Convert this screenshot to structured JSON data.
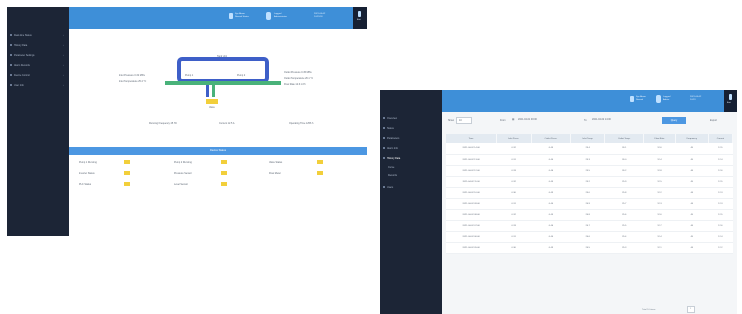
{
  "left_screen": {
    "topbar": {
      "items": [
        {
          "icon": "monitor-icon",
          "line1": "Sys Alarm",
          "line2": "Normal Status"
        },
        {
          "icon": "user-icon",
          "line1": "Logged",
          "line2": "Administrator"
        },
        {
          "icon": "clock-icon",
          "line1": "2021-04-02",
          "line2": "14:23:18"
        }
      ],
      "power_label": "Exit"
    },
    "sidebar": {
      "items": [
        {
          "label": "Real-time Status",
          "active": true
        },
        {
          "label": "History Data",
          "active": false
        },
        {
          "label": "Parameter Settings",
          "active": false
        },
        {
          "label": "Alarm Records",
          "active": false
        },
        {
          "label": "Device Control",
          "active": false
        },
        {
          "label": "User Info",
          "active": false
        }
      ]
    },
    "diagram": {
      "top_label": "Tank Unit",
      "left_box": "Pump 1",
      "right_box": "Pump 2",
      "left_notes": [
        "Inlet Pressure 0.32 MPa",
        "Inlet Temperature 25.4 °C"
      ],
      "right_notes": [
        "Outlet Pressure 0.45 MPa",
        "Outlet Temperature 26.1 °C",
        "Flow Rate 12.6 m³/h"
      ],
      "valve_label": "Valve",
      "bottom_notes": [
        "Running Frequency 45 Hz",
        "Current 12.5 A",
        "Operating Time 1256 h"
      ]
    },
    "status": {
      "title": "Device Status",
      "rows": [
        [
          "Pump 1 Running",
          "Pump 2 Running",
          "Valve Status"
        ],
        [
          "Inverter Status",
          "Pressure Sensor",
          "Flow Meter"
        ],
        [
          "PLC Status",
          "Level Sensor",
          ""
        ]
      ]
    },
    "colors": {
      "accent": "#3e8fd8",
      "sidebar": "#1c2536",
      "pipe_blue": "#3e5fc8",
      "pipe_green": "#49b27a",
      "indicator": "#f2cf3b"
    }
  },
  "right_screen": {
    "topbar": {
      "items": [
        {
          "icon": "monitor-icon",
          "line1": "Sys Alarm",
          "line2": "Normal"
        },
        {
          "icon": "user-icon",
          "line1": "Logged",
          "line2": "Admin"
        },
        {
          "icon": "clock-icon",
          "line1": "2021-04-02",
          "line2": "14:23"
        }
      ],
      "power_label": "Exit"
    },
    "sidebar": {
      "items": [
        {
          "label": "Overview",
          "active": false
        },
        {
          "label": "Status",
          "active": false
        },
        {
          "label": "Parameters",
          "active": false
        },
        {
          "label": "Alarm Info",
          "active": false
        },
        {
          "label": "History Data",
          "active": true
        },
        {
          "label": "Curve",
          "active": false
        },
        {
          "label": "Records",
          "active": false
        },
        {
          "label": "Users",
          "active": false
        }
      ]
    },
    "toolbar": {
      "rows_label": "Show",
      "rows_value": "10",
      "from_label": "From",
      "from_value": "2021-04-01 00:00",
      "to_label": "To",
      "to_value": "2021-04-02 14:00",
      "query_button": "Query",
      "export_link": "Export"
    },
    "table": {
      "headers": [
        "Time",
        "Inlet Press.",
        "Outlet Press.",
        "Inlet Temp.",
        "Outlet Temp.",
        "Flow Rate",
        "Frequency",
        "Current"
      ],
      "rows": [
        [
          "2021-04-02 14:00",
          "0.32",
          "0.45",
          "25.4",
          "26.1",
          "12.6",
          "45",
          "12.5"
        ],
        [
          "2021-04-02 13:00",
          "0.31",
          "0.44",
          "25.3",
          "26.0",
          "12.4",
          "45",
          "12.4"
        ],
        [
          "2021-04-02 12:00",
          "0.33",
          "0.46",
          "25.5",
          "26.2",
          "12.8",
          "46",
          "12.6"
        ],
        [
          "2021-04-02 11:00",
          "0.32",
          "0.45",
          "25.2",
          "25.9",
          "12.5",
          "45",
          "12.5"
        ],
        [
          "2021-04-02 10:00",
          "0.30",
          "0.43",
          "25.0",
          "25.8",
          "12.2",
          "44",
          "12.3"
        ],
        [
          "2021-04-02 09:00",
          "0.31",
          "0.44",
          "24.9",
          "25.7",
          "12.3",
          "44",
          "12.3"
        ],
        [
          "2021-04-02 08:00",
          "0.32",
          "0.45",
          "24.8",
          "25.6",
          "12.6",
          "45",
          "12.5"
        ],
        [
          "2021-04-02 07:00",
          "0.33",
          "0.46",
          "24.7",
          "25.5",
          "12.7",
          "46",
          "12.6"
        ],
        [
          "2021-04-02 06:00",
          "0.31",
          "0.44",
          "24.6",
          "25.4",
          "12.4",
          "45",
          "12.4"
        ],
        [
          "2021-04-02 05:00",
          "0.30",
          "0.43",
          "24.5",
          "25.3",
          "12.1",
          "44",
          "12.2"
        ]
      ]
    },
    "pager": {
      "info": "Total 10 items",
      "page": "1"
    }
  }
}
